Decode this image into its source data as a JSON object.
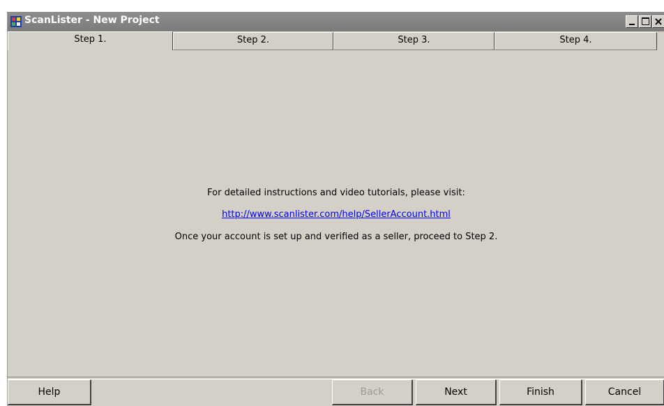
{
  "window": {
    "title": "ScanLister - New Project",
    "icon": "app-window-icon"
  },
  "tabs": [
    {
      "label": "Step 1.",
      "active": true
    },
    {
      "label": "Step 2.",
      "active": false
    },
    {
      "label": "Step 3.",
      "active": false
    },
    {
      "label": "Step 4.",
      "active": false
    }
  ],
  "content": {
    "instructions": "For detailed instructions and video tutorials, please visit:",
    "link": "http://www.scanlister.com/help/SellerAccount.html",
    "proceed": "Once your account is set up and verified as a seller, proceed to Step 2."
  },
  "buttons": {
    "help": "Help",
    "back": "Back",
    "next": "Next",
    "finish": "Finish",
    "cancel": "Cancel"
  },
  "colors": {
    "window_bg": "#d4d0c8",
    "titlebar": "#808080",
    "link": "#0000ee"
  }
}
